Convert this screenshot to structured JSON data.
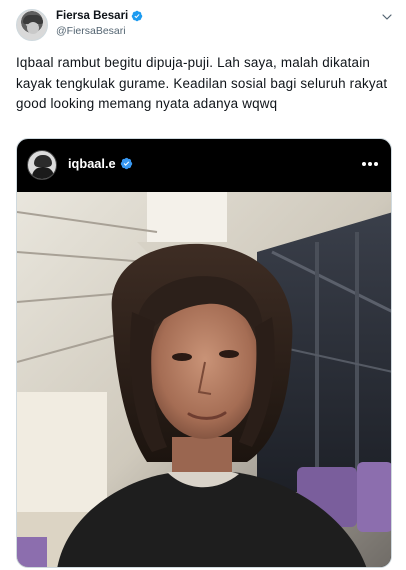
{
  "tweet": {
    "display_name": "Fiersa Besari",
    "handle": "@FiersaBesari",
    "text": "Iqbaal rambut begitu dipuja-puji. Lah saya, malah dikatain kayak tengkulak gurame. Keadilan sosial bagi seluruh rakyat good looking memang nyata adanya wqwq",
    "verified_icon": "verified-badge-icon",
    "menu_icon": "chevron-down-icon"
  },
  "instagram_post": {
    "username": "iqbaal.e",
    "verified_icon": "verified-badge-icon",
    "more_icon": "more-horizontal-icon",
    "photo": "selfie-photo"
  },
  "colors": {
    "verified": "#1d9bf0",
    "handle_gray": "#536471",
    "text": "#0f1419",
    "ig_background": "#000000"
  }
}
